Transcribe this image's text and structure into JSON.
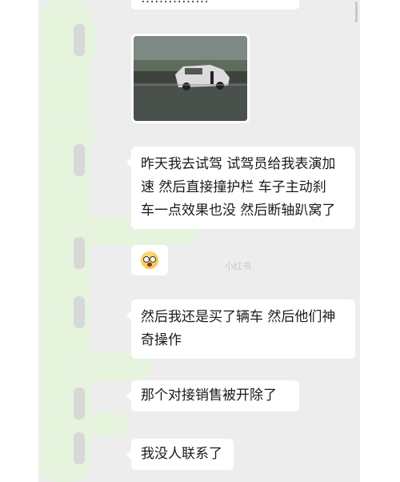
{
  "chat": {
    "top_fragment": "……………",
    "messages": [
      {
        "type": "image",
        "alt": "photo"
      },
      {
        "type": "text",
        "lines": [
          "昨天我去试驾 试驾员给我表演加",
          "速 然后直接撞护栏 车子主动刹",
          "车一点效果也没 然后断轴趴窝了"
        ]
      },
      {
        "type": "emoji",
        "icon": "flushed-face-icon"
      },
      {
        "type": "text",
        "lines": [
          "然后我还是买了辆车 然后他们神",
          "奇操作"
        ]
      },
      {
        "type": "text",
        "lines": [
          "那个对接销售被开除了"
        ]
      },
      {
        "type": "text",
        "lines": [
          "我没人联系了"
        ]
      }
    ]
  },
  "watermark": "小红书",
  "colors": {
    "background": "#ededed",
    "bubble": "#ffffff",
    "redaction": "#e6f4de"
  }
}
